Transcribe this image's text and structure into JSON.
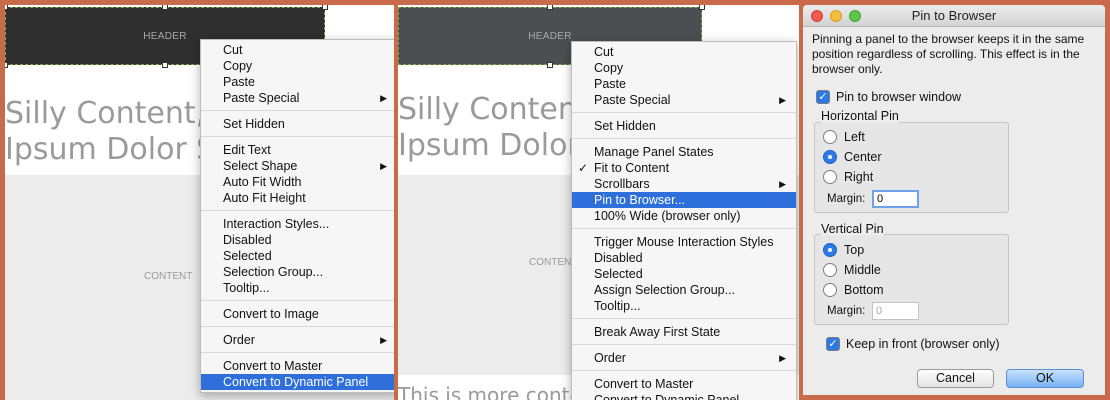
{
  "canvas1": {
    "header_label": "HEADER",
    "big_text_line1": "Silly Content, Lo",
    "big_text_line2": "Ipsum Dolor Sit",
    "content_label": "CONTENT"
  },
  "menu1": {
    "groups": [
      [
        "Cut",
        "Copy",
        "Paste",
        "Paste Special"
      ],
      [
        "Set Hidden"
      ],
      [
        "Edit Text",
        "Select Shape",
        "Auto Fit Width",
        "Auto Fit Height"
      ],
      [
        "Interaction Styles...",
        "Disabled",
        "Selected",
        "Selection Group...",
        "Tooltip..."
      ],
      [
        "Convert to Image"
      ],
      [
        "Order"
      ],
      [
        "Convert to Master",
        "Convert to Dynamic Panel"
      ]
    ],
    "submenu_items": [
      "Paste Special",
      "Select Shape",
      "Order"
    ],
    "highlighted": "Convert to Dynamic Panel"
  },
  "canvas2": {
    "header_label": "HEADER",
    "big_text_line1": "Silly Content, Lo",
    "big_text_line2": "Ipsum Dolor Sit",
    "content_label": "CONTENT",
    "more_text": "This is more content ..."
  },
  "menu2": {
    "groups": [
      [
        "Cut",
        "Copy",
        "Paste",
        "Paste Special"
      ],
      [
        "Set Hidden"
      ],
      [
        "Manage Panel States",
        "Fit to Content",
        "Scrollbars",
        "Pin to Browser...",
        "100% Wide (browser only)"
      ],
      [
        "Trigger Mouse Interaction Styles",
        "Disabled",
        "Selected",
        "Assign Selection Group...",
        "Tooltip..."
      ],
      [
        "Break Away First State"
      ],
      [
        "Order"
      ],
      [
        "Convert to Master",
        "Convert to Dynamic Panel"
      ]
    ],
    "submenu_items": [
      "Paste Special",
      "Scrollbars",
      "Order"
    ],
    "checked_items": [
      "Fit to Content"
    ],
    "highlighted": "Pin to Browser..."
  },
  "dialog": {
    "title": "Pin to Browser",
    "description": "Pinning a panel to the browser keeps it in the same position regardless of scrolling. This effect is in the browser only.",
    "pin_checkbox_label": "Pin to browser window",
    "pin_checked": true,
    "horizontal": {
      "title": "Horizontal Pin",
      "options": [
        "Left",
        "Center",
        "Right"
      ],
      "selected": "Center",
      "margin_label": "Margin:",
      "margin_value": "0"
    },
    "vertical": {
      "title": "Vertical Pin",
      "options": [
        "Top",
        "Middle",
        "Bottom"
      ],
      "selected": "Top",
      "margin_label": "Margin:",
      "margin_value": "0"
    },
    "keep_front_label": "Keep in front (browser only)",
    "keep_front_checked": true,
    "cancel_label": "Cancel",
    "ok_label": "OK"
  },
  "colors": {
    "background": "#c96a4a",
    "highlight": "#2f6fdc",
    "header_dark": "#2f2f2f"
  }
}
